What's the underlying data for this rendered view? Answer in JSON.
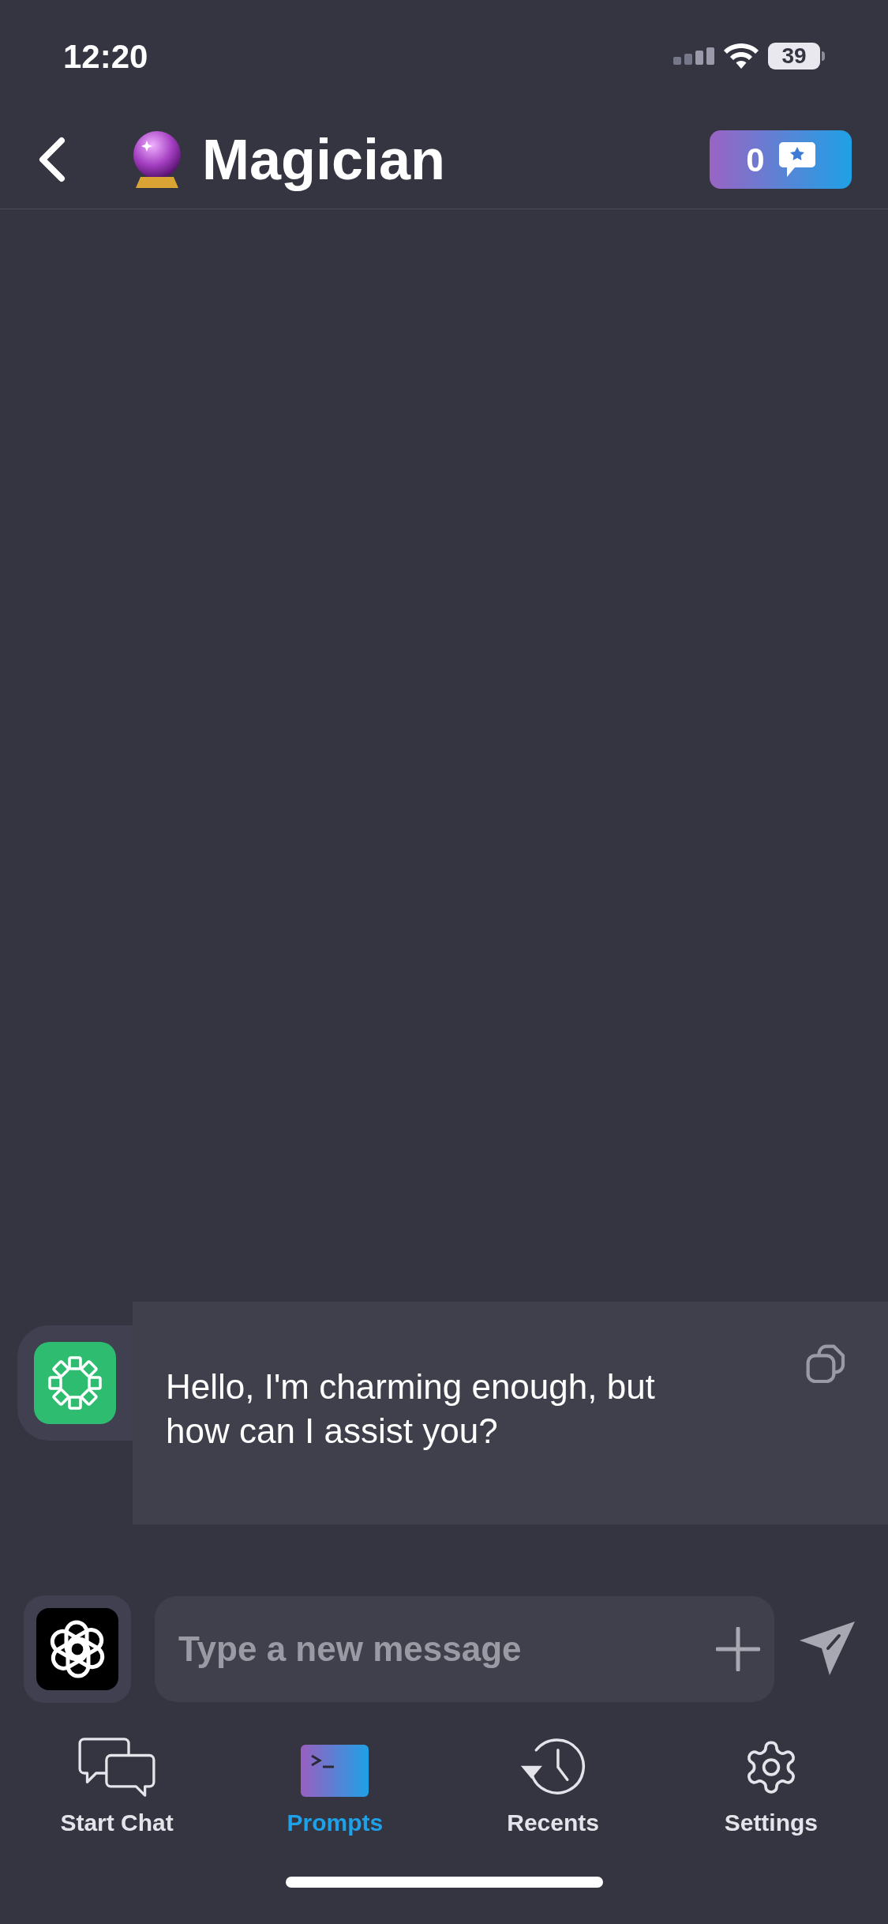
{
  "status_bar": {
    "time": "12:20",
    "battery": "39"
  },
  "header": {
    "title": "Magician",
    "credits": "0"
  },
  "messages": [
    {
      "text": "Hello, I'm charming enough, but how can I assist you?"
    }
  ],
  "composer": {
    "placeholder": "Type a new message"
  },
  "tabs": [
    {
      "label": "Start Chat",
      "selected": false,
      "kind": "chat"
    },
    {
      "label": "Prompts",
      "selected": true,
      "kind": "prompts"
    },
    {
      "label": "Recents",
      "selected": false,
      "kind": "recents"
    },
    {
      "label": "Settings",
      "selected": false,
      "kind": "settings"
    }
  ]
}
